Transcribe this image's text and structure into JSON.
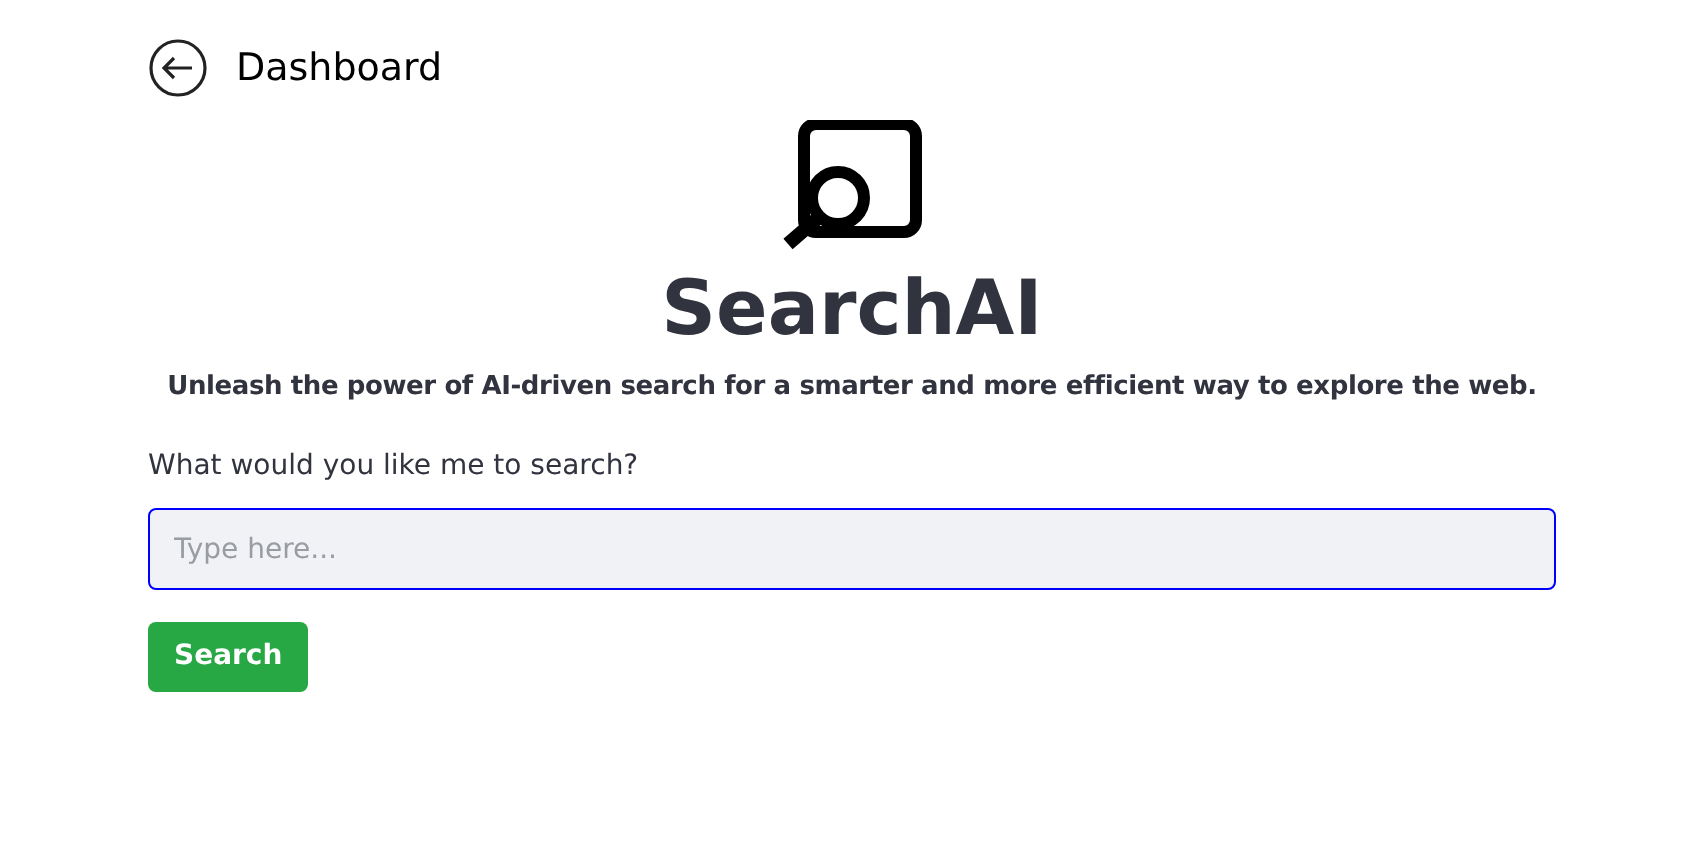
{
  "header": {
    "back_label": "Dashboard"
  },
  "hero": {
    "title": "SearchAI",
    "tagline": "Unleash the power of AI-driven search for a smarter and more efficient way to explore the web."
  },
  "form": {
    "label": "What would you like me to search?",
    "placeholder": "Type here...",
    "focused": true,
    "button": "Search"
  }
}
